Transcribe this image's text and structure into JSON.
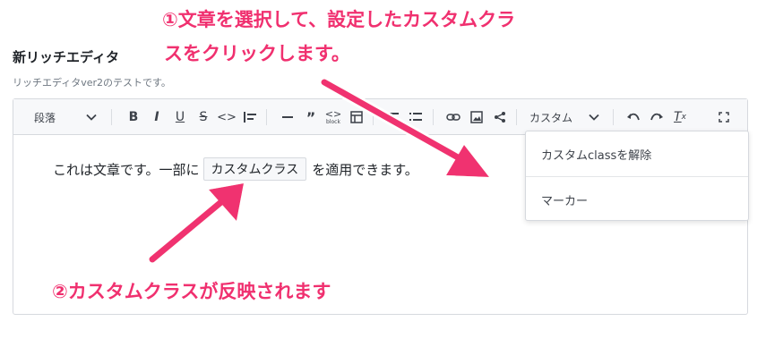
{
  "field": {
    "title": "新リッチエディタ",
    "description": "リッチエディタver2のテストです。"
  },
  "toolbar": {
    "paragraph_select": "段落",
    "custom_select": "カスタム",
    "block_caption": "block",
    "icons": [
      "bold-icon",
      "italic-icon",
      "underline-icon",
      "strikethrough-icon",
      "code-icon",
      "align-left-icon",
      "horizontal-rule-icon",
      "quote-icon",
      "code-block-icon",
      "table-icon",
      "bullet-list-icon",
      "ordered-list-icon",
      "link-icon",
      "image-icon",
      "share-icon",
      "undo-icon",
      "redo-icon",
      "clear-format-icon",
      "fullscreen-icon"
    ]
  },
  "content": {
    "before": "これは文章です。一部に",
    "highlighted": "カスタムクラス",
    "after": "を適用できます。"
  },
  "dropdown": {
    "items": [
      "カスタムclassを解除",
      "マーカー"
    ]
  },
  "annotations": {
    "step1_line1": "①文章を選択して、設定したカスタムクラ",
    "step1_line2": "スをクリックします。",
    "step2": "②カスタムクラスが反映されます"
  },
  "colors": {
    "annotation": "#f0306f",
    "toolbar_bg": "#f7f8fa",
    "border": "#d6d9de"
  }
}
